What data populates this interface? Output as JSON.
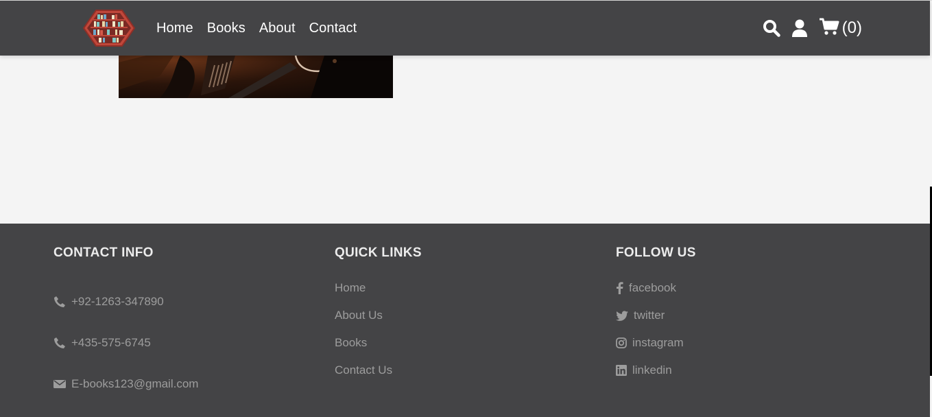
{
  "header": {
    "logo_icon": "bookshelf-hexagon-logo",
    "nav": [
      {
        "label": "Home"
      },
      {
        "label": "Books"
      },
      {
        "label": "About"
      },
      {
        "label": "Contact"
      }
    ],
    "icons": [
      "search-icon",
      "user-icon",
      "cart-icon"
    ],
    "cart_count": "(0)"
  },
  "footer": {
    "contact": {
      "title": "CONTACT INFO",
      "items": [
        {
          "icon": "phone-icon",
          "text": "+92-1263-347890"
        },
        {
          "icon": "phone-icon",
          "text": "+435-575-6745"
        },
        {
          "icon": "envelope-icon",
          "text": "E-books123@gmail.com"
        }
      ]
    },
    "quick_links": {
      "title": "QUICK LINKS",
      "items": [
        {
          "label": "Home"
        },
        {
          "label": "About Us"
        },
        {
          "label": "Books"
        },
        {
          "label": "Contact Us"
        }
      ]
    },
    "follow": {
      "title": "FOLLOW US",
      "items": [
        {
          "icon": "facebook-icon",
          "label": "facebook"
        },
        {
          "icon": "twitter-icon",
          "label": "twitter"
        },
        {
          "icon": "instagram-icon",
          "label": "instagram"
        },
        {
          "icon": "linkedin-icon",
          "label": "linkedin"
        }
      ]
    }
  },
  "colors": {
    "header_bg": "#444446",
    "footer_bg": "#444446",
    "page_bg": "#f4f4f4",
    "footer_text": "#9d9d9d",
    "footer_title": "#ececec",
    "logo_red": "#c0473a"
  }
}
